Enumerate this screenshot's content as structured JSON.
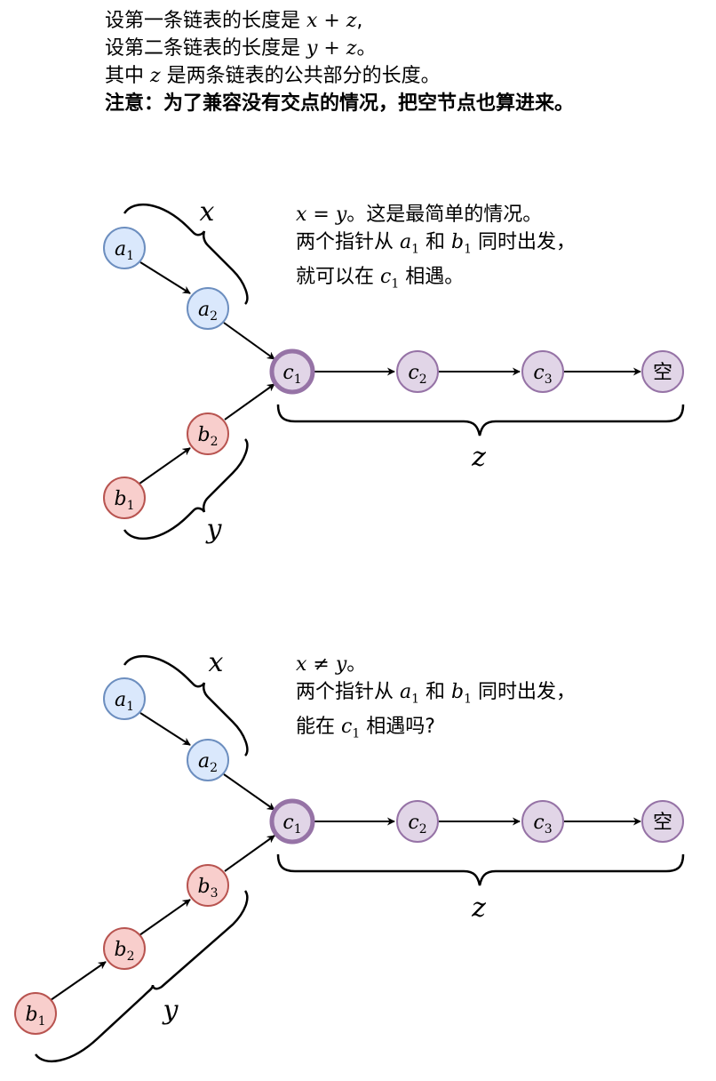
{
  "intro": {
    "line1_pre": "设第一条链表的长度是 ",
    "line1_math": "x + z",
    "line1_post": ",",
    "line2_pre": "设第二条链表的长度是 ",
    "line2_math": "y + z",
    "line2_post": "。",
    "line3_pre": "其中 ",
    "line3_math": "z",
    "line3_post": " 是两条链表的公共部分的长度。",
    "line4": "注意：为了兼容没有交点的情况，把空节点也算进来。"
  },
  "case1": {
    "note1_math": "x = y",
    "note1_text": "。这是最简单的情况。",
    "note2_a": "两个指针从 ",
    "note2_mid": " 和 ",
    "note2_end": " 同时出发，",
    "note3_a": "就可以在 ",
    "note3_end": " 相遇。",
    "label_x": "x",
    "label_y": "y",
    "label_z": "z",
    "nodes": {
      "a1": {
        "base": "a",
        "sub": "1"
      },
      "a2": {
        "base": "a",
        "sub": "2"
      },
      "b1": {
        "base": "b",
        "sub": "1"
      },
      "b2": {
        "base": "b",
        "sub": "2"
      },
      "c1": {
        "base": "c",
        "sub": "1"
      },
      "c2": {
        "base": "c",
        "sub": "2"
      },
      "c3": {
        "base": "c",
        "sub": "3"
      },
      "null": {
        "label": "空"
      }
    }
  },
  "case2": {
    "note1_math": "x ≠ y",
    "note1_text": "。",
    "note2_a": "两个指针从 ",
    "note2_mid": " 和 ",
    "note2_end": " 同时出发，",
    "note3_a": "能在 ",
    "note3_end": " 相遇吗?",
    "label_x": "x",
    "label_y": "y",
    "label_z": "z",
    "nodes": {
      "a1": {
        "base": "a",
        "sub": "1"
      },
      "a2": {
        "base": "a",
        "sub": "2"
      },
      "b1": {
        "base": "b",
        "sub": "1"
      },
      "b2": {
        "base": "b",
        "sub": "2"
      },
      "b3": {
        "base": "b",
        "sub": "3"
      },
      "c1": {
        "base": "c",
        "sub": "1"
      },
      "c2": {
        "base": "c",
        "sub": "2"
      },
      "c3": {
        "base": "c",
        "sub": "3"
      },
      "null": {
        "label": "空"
      }
    }
  },
  "colors": {
    "a_fill": "#dae8fc",
    "a_stroke": "#6c8ebf",
    "b_fill": "#f8cecc",
    "b_stroke": "#b85450",
    "c_fill": "#e1d5e7",
    "c_stroke": "#9673a6",
    "ink": "#000000"
  }
}
